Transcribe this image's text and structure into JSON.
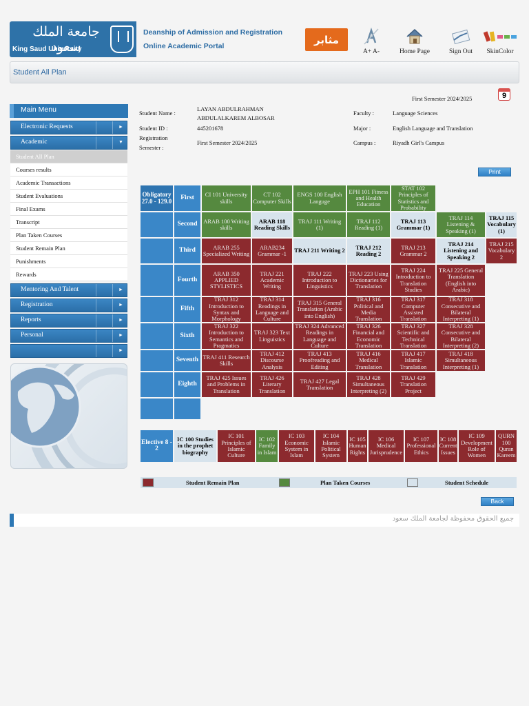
{
  "header": {
    "logo_arabic": "جامعة الملك سعود",
    "logo_english": "King Saud University",
    "dept_line1": "Deanship of Admission and Registration",
    "dept_line2": "Online Academic Portal",
    "mathair_label": "مثابر",
    "font_size_label": "A+ A-",
    "home_label": "Home Page",
    "signout_label": "Sign Out",
    "skin_label": "SkinColor"
  },
  "page_title": "Student All Plan",
  "semester_top": "First Semester 2024/2025",
  "calendar_day": "9",
  "sidebar": {
    "main_menu": "Main Menu",
    "sections": [
      {
        "label": "Electronic Requests"
      },
      {
        "label": "Academic"
      }
    ],
    "academic_items": [
      "Student All Plan",
      "Courses results",
      "Academic Transactions",
      "Student Evaluations",
      "Final Exams",
      "Transcript",
      "Plan Taken Courses",
      "Student Remain Plan",
      "Punishments",
      "Rewards"
    ],
    "lower_sections": [
      "Mentoring And Talent",
      "Registration",
      "Reports",
      "Personal",
      ""
    ]
  },
  "student": {
    "name_label": "Student Name :",
    "name_line1": "LAYAN ABDULRAHMAN",
    "name_line2": "ABDULALKAREM ALBOSAR",
    "id_label": "Student ID :",
    "id_value": "445201678",
    "reg_label1": "Registration",
    "reg_label2": "Semester :",
    "reg_value": "First Semester 2024/2025",
    "faculty_label": "Faculty :",
    "faculty_value": "Language Sciences",
    "major_label": "Major :",
    "major_value": "English Language and Translation",
    "campus_label": "Campus :",
    "campus_value": "Riyadh Girl's Campus"
  },
  "buttons": {
    "print": "Print",
    "back": "Back"
  },
  "plan": {
    "obligatory_label": "Obligatory 27.0 - 129.0",
    "elective_label": "Elective  8 - 2",
    "levels": [
      {
        "name": "First",
        "courses": [
          {
            "text": "CI 101 University skills",
            "s": "g"
          },
          {
            "text": "CT 102 Computer Skills",
            "s": "g"
          },
          {
            "text": "ENGS 100 English Languge",
            "s": "g"
          },
          {
            "text": "EPH 101 Fitness and Health Education",
            "s": "g"
          },
          {
            "text": "STAT 102 Principles of Statistics and Probability",
            "s": "g"
          }
        ]
      },
      {
        "name": "Second",
        "courses": [
          {
            "text": "ARAB 100 Writing skills",
            "s": "g"
          },
          {
            "text": "ARAB 118 Reading Skills",
            "s": "w"
          },
          {
            "text": "TRAJ 111 Writing (1)",
            "s": "g"
          },
          {
            "text": "TRAJ 112 Reading (1)",
            "s": "g"
          },
          {
            "text": "TRAJ 113 Grammar (1)",
            "s": "w"
          },
          {
            "text": "TRAJ 114 Listening & Speaking (1)",
            "s": "g"
          },
          {
            "text": "TRAJ 115 Vocabulary (1)",
            "s": "w"
          }
        ]
      },
      {
        "name": "Third",
        "courses": [
          {
            "text": "ARAB 255 Specialized Writing",
            "s": "r"
          },
          {
            "text": "ARAB234 Grammar -1",
            "s": "r"
          },
          {
            "text": "TRAJ 211 Writing 2",
            "s": "w"
          },
          {
            "text": "TRAJ 212 Reading 2",
            "s": "w"
          },
          {
            "text": "TRAJ 213 Grammar 2",
            "s": "r"
          },
          {
            "text": "TRAJ 214 Listening and Speaking 2",
            "s": "w"
          },
          {
            "text": "TRAJ 215 Vocabulary 2",
            "s": "r"
          }
        ]
      },
      {
        "name": "Fourth",
        "courses": [
          {
            "text": "ARAB 350 APPLIED STYLISTICS",
            "s": "r"
          },
          {
            "text": "TRAJ 221 Academic Writing",
            "s": "r"
          },
          {
            "text": "TRAJ 222 Introduction to Linguistics",
            "s": "r"
          },
          {
            "text": "TRAJ 223 Using Dictionaries for Translation",
            "s": "r"
          },
          {
            "text": "TRAJ 224 Introduction to Translation Studies",
            "s": "r"
          },
          {
            "text": "TRAJ 225 General Translation (English into Arabic)",
            "s": "r"
          }
        ]
      },
      {
        "name": "Fifth",
        "courses": [
          {
            "text": "TRAJ 312 Introduction to Syntax and Morphology",
            "s": "r"
          },
          {
            "text": "TRAJ 314 Readings in Language and Culture",
            "s": "r"
          },
          {
            "text": "TRAJ 315 General Translation (Arabic into English)",
            "s": "r"
          },
          {
            "text": "TRAJ 316 Political and Media Translation",
            "s": "r"
          },
          {
            "text": "TRAJ 317 Computer Assisted Translation",
            "s": "r"
          },
          {
            "text": "TRAJ 318 Consecutive and Bilateral Interpreting (1)",
            "s": "r"
          }
        ]
      },
      {
        "name": "Sixth",
        "courses": [
          {
            "text": "TRAJ 322 Introduction to Semantics and Pragmatics",
            "s": "r"
          },
          {
            "text": "TRAJ 323 Text Linguistics",
            "s": "r"
          },
          {
            "text": "TRAJ 324 Advanced Readings in Language and Culture",
            "s": "r"
          },
          {
            "text": "TRAJ 326 Financial and Economic Translation",
            "s": "r"
          },
          {
            "text": "TRAJ 327 Scientific and Technical Translation",
            "s": "r"
          },
          {
            "text": "TRAJ 328 Consecutive and Bilateral Interpreting (2)",
            "s": "r"
          }
        ]
      },
      {
        "name": "Seventh",
        "courses": [
          {
            "text": "TRAJ 411 Research Skills",
            "s": "r"
          },
          {
            "text": "TRAJ 412 Discourse Analysis",
            "s": "r"
          },
          {
            "text": "TRAJ 413 Proofreading and Editing",
            "s": "r"
          },
          {
            "text": "TRAJ 416 Medical Translation",
            "s": "r"
          },
          {
            "text": "TRAJ 417 Islamic Translation",
            "s": "r"
          },
          {
            "text": "TRAJ 418 Simultaneous Interpreting (1)",
            "s": "r"
          }
        ]
      },
      {
        "name": "Eighth",
        "courses": [
          {
            "text": "TRAJ 425 Issues and Problems in Translation",
            "s": "r"
          },
          {
            "text": "TRAJ 426 Literary Translation",
            "s": "r"
          },
          {
            "text": "TRAJ 427 Legal Translation",
            "s": "r"
          },
          {
            "text": "TRAJ 428 Simultaneous Interpreting (2)",
            "s": "r"
          },
          {
            "text": "TRAJ 429 Translation Project",
            "s": "r"
          }
        ]
      }
    ],
    "electives": [
      {
        "text": "IC 100 Studies in the prophet biography",
        "s": "w"
      },
      {
        "text": "IC 101 Principles of Islamic Culture",
        "s": "r"
      },
      {
        "text": "IC 102 Family in Islam",
        "s": "g"
      },
      {
        "text": "IC 103 Economic System in Islam",
        "s": "r"
      },
      {
        "text": "IC 104 Islamic Political System",
        "s": "r"
      },
      {
        "text": "IC 105 Human Rights",
        "s": "r"
      },
      {
        "text": "IC 106 Medical Jurisprudence",
        "s": "r"
      },
      {
        "text": "IC 107 Professional Ethics",
        "s": "r"
      },
      {
        "text": "IC 108 Current Issues",
        "s": "r"
      },
      {
        "text": "IC 109 Development Role of Women",
        "s": "r"
      },
      {
        "text": "QURN 100 Quran Kareem",
        "s": "r"
      }
    ]
  },
  "legend": {
    "remain": "Student Remain Plan",
    "taken": "Plan Taken Courses",
    "schedule": "Student Schedule"
  },
  "footer": "جميع الحقوق محفوظة لجامعة الملك سعود",
  "colors": {
    "remain": "#8c2a2e",
    "taken": "#55893f",
    "schedule": "#d7e3ec",
    "header_blue": "#3a87c8",
    "accent_orange": "#e46a1c"
  }
}
